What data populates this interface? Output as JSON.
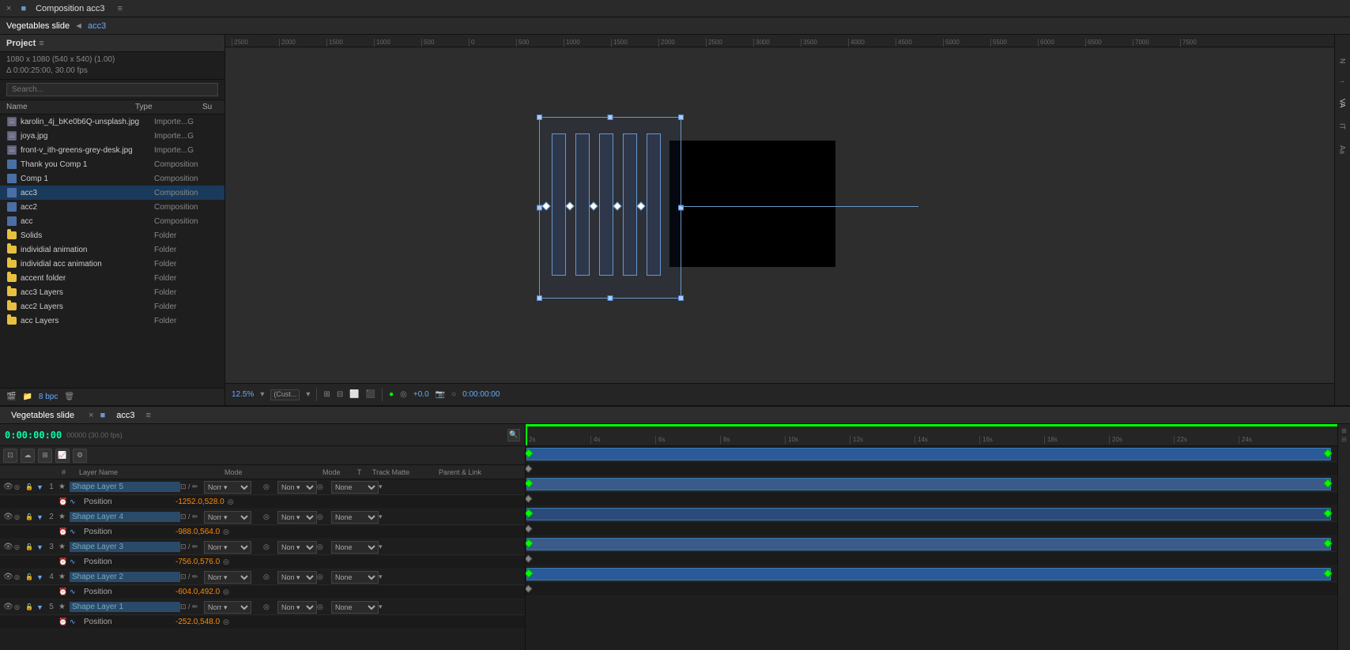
{
  "topbar": {
    "close": "×",
    "comp_icon": "■",
    "title": "Composition acc3",
    "menu_icon": "≡"
  },
  "breadcrumb": {
    "comp": "Vegetables slide",
    "arrow": "◄",
    "sub": "acc3"
  },
  "project": {
    "title": "Project",
    "menu": "≡"
  },
  "project_info": {
    "line1": "1080 x 1080  (540 x 540) (1.00)",
    "line2": "Δ 0:00:25:00, 30.00 fps"
  },
  "search_placeholder": "Search...",
  "list_headers": {
    "name": "Name",
    "type": "Type",
    "sub": "Su"
  },
  "project_items": [
    {
      "name": "karolin_4j_bKe0b6Q-unsplash.jpg",
      "type": "Importe...G",
      "icon": "image",
      "selected": false
    },
    {
      "name": "joya.jpg",
      "type": "Importe...G",
      "icon": "image",
      "selected": false
    },
    {
      "name": "front-v_ith-greens-grey-desk.jpg",
      "type": "Importe...G",
      "icon": "image",
      "selected": false
    },
    {
      "name": "Thank you Comp 1",
      "type": "Composition",
      "icon": "comp",
      "selected": false
    },
    {
      "name": "Comp 1",
      "type": "Composition",
      "icon": "comp",
      "selected": false
    },
    {
      "name": "acc3",
      "type": "Composition",
      "icon": "comp",
      "selected": true
    },
    {
      "name": "acc2",
      "type": "Composition",
      "icon": "comp",
      "selected": false
    },
    {
      "name": "acc",
      "type": "Composition",
      "icon": "comp",
      "selected": false
    },
    {
      "name": "Solids",
      "type": "Folder",
      "icon": "folder",
      "selected": false
    },
    {
      "name": "individial animation",
      "type": "Folder",
      "icon": "folder",
      "selected": false
    },
    {
      "name": "individial acc animation",
      "type": "Folder",
      "icon": "folder",
      "selected": false
    },
    {
      "name": "accent folder",
      "type": "Folder",
      "icon": "folder",
      "selected": false
    },
    {
      "name": "acc3 Layers",
      "type": "Folder",
      "icon": "folder",
      "selected": false
    },
    {
      "name": "acc2 Layers",
      "type": "Folder",
      "icon": "folder",
      "selected": false
    },
    {
      "name": "acc Layers",
      "type": "Folder",
      "icon": "folder",
      "selected": false
    }
  ],
  "panel_bottom": {
    "bpc": "8 bpc"
  },
  "viewport": {
    "zoom": "12.5%",
    "preset": "(Cust...",
    "time": "0:00:00:00",
    "green_value": "+0.0"
  },
  "timeline": {
    "tab1": "Vegetables slide",
    "tab2": "acc3",
    "time_display": "0:00:00:00",
    "fps": "00000 (30.00 fps)"
  },
  "tl_columns": {
    "mode": "Mode",
    "t": "T",
    "track_matte": "Track Matte",
    "parent_link": "Parent & Link"
  },
  "ruler_labels": [
    "2s",
    "4s",
    "6s",
    "8s",
    "10s",
    "12s",
    "14s",
    "16s",
    "18s",
    "20s",
    "22s",
    "24s"
  ],
  "layers": [
    {
      "num": "1",
      "name": "Shape Layer 5",
      "expanded": true,
      "sub_name": "Position",
      "sub_value": "-1252.0,528.0",
      "mode": "Norr",
      "matte": "Non",
      "parent": "None"
    },
    {
      "num": "2",
      "name": "Shape Layer 4",
      "expanded": true,
      "sub_name": "Position",
      "sub_value": "-988.0,564.0",
      "mode": "Norr",
      "matte": "Non",
      "parent": "None"
    },
    {
      "num": "3",
      "name": "Shape Layer 3",
      "expanded": true,
      "sub_name": "Position",
      "sub_value": "-756.0,576.0",
      "mode": "Norr",
      "matte": "Non",
      "parent": "None"
    },
    {
      "num": "4",
      "name": "Shape Layer 2",
      "expanded": true,
      "sub_name": "Position",
      "sub_value": "-604.0,492.0",
      "mode": "Norr",
      "matte": "Non",
      "parent": "None"
    },
    {
      "num": "5",
      "name": "Shape Layer 1",
      "expanded": true,
      "sub_name": "Position",
      "sub_value": "-252.0,548.0",
      "mode": "Norr",
      "matte": "Non",
      "parent": "None"
    }
  ]
}
